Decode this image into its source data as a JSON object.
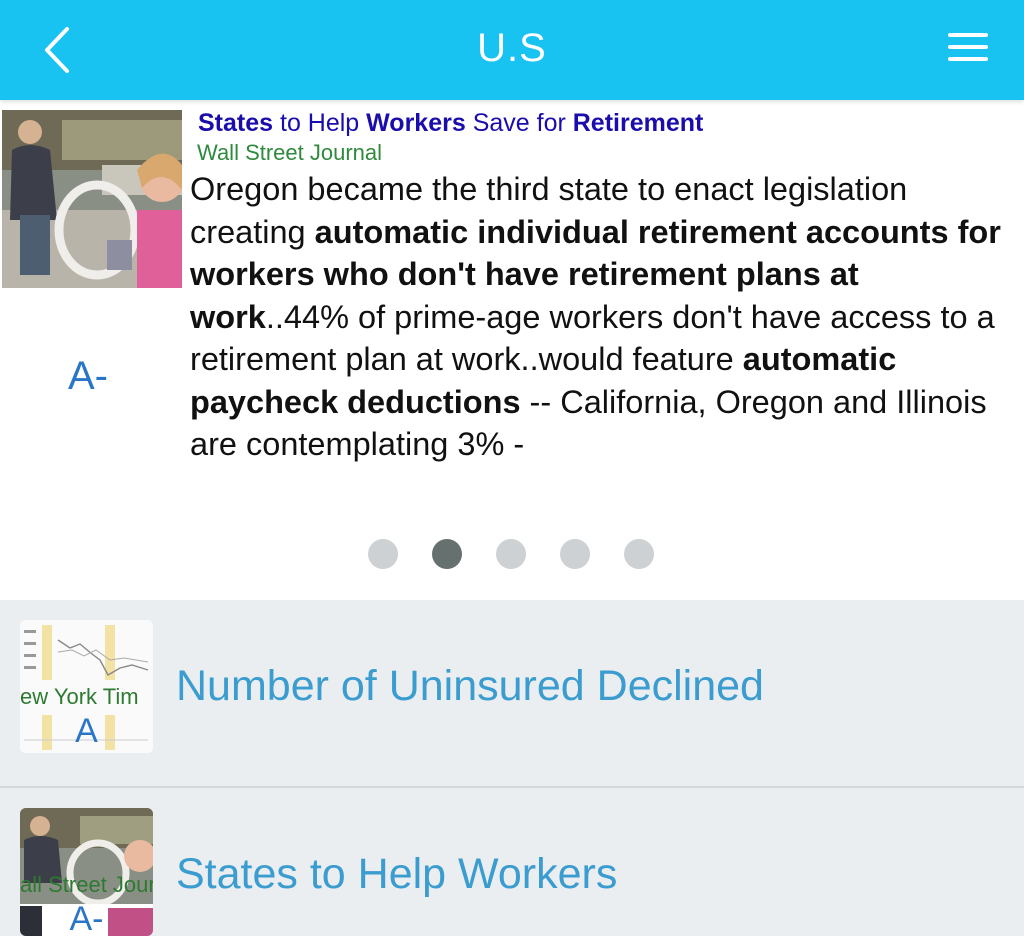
{
  "header": {
    "title": "U.S",
    "back_icon": "chevron-left-icon",
    "menu_icon": "hamburger-menu-icon",
    "background": "#18c2f1"
  },
  "featured": {
    "title_parts": [
      {
        "text": "States",
        "bold": true
      },
      {
        "text": " to Help ",
        "bold": false
      },
      {
        "text": "Workers",
        "bold": true
      },
      {
        "text": " Save for ",
        "bold": false
      },
      {
        "text": "Retirement",
        "bold": true
      }
    ],
    "source": "Wall Street Journal",
    "grade": "A-",
    "snippet_parts": [
      {
        "text": "Oregon became the third state to enact legislation creating ",
        "bold": false
      },
      {
        "text": "automatic individual retirement accounts for workers who don't have retirement plans at work",
        "bold": true
      },
      {
        "text": "..44% of prime-age workers don't have access to a retirement plan at work..would feature ",
        "bold": false
      },
      {
        "text": "automatic paycheck deductions",
        "bold": true
      },
      {
        "text": " -- California, Oregon and Illinois are contemplating 3% -",
        "bold": false
      }
    ]
  },
  "pager": {
    "count": 5,
    "active_index": 1
  },
  "list": [
    {
      "title": "Number of Uninsured Declined",
      "thumb_source": "ew York Tim",
      "thumb_grade": "A"
    },
    {
      "title": "States to Help Workers",
      "thumb_source": "all Street Journ",
      "thumb_grade": "A-"
    }
  ],
  "colors": {
    "link_title": "#1a0dab",
    "source_green": "#2e8a3c",
    "grade_blue": "#2a76c6",
    "list_title": "#3a9ccf",
    "list_bg": "#ebeef1"
  }
}
